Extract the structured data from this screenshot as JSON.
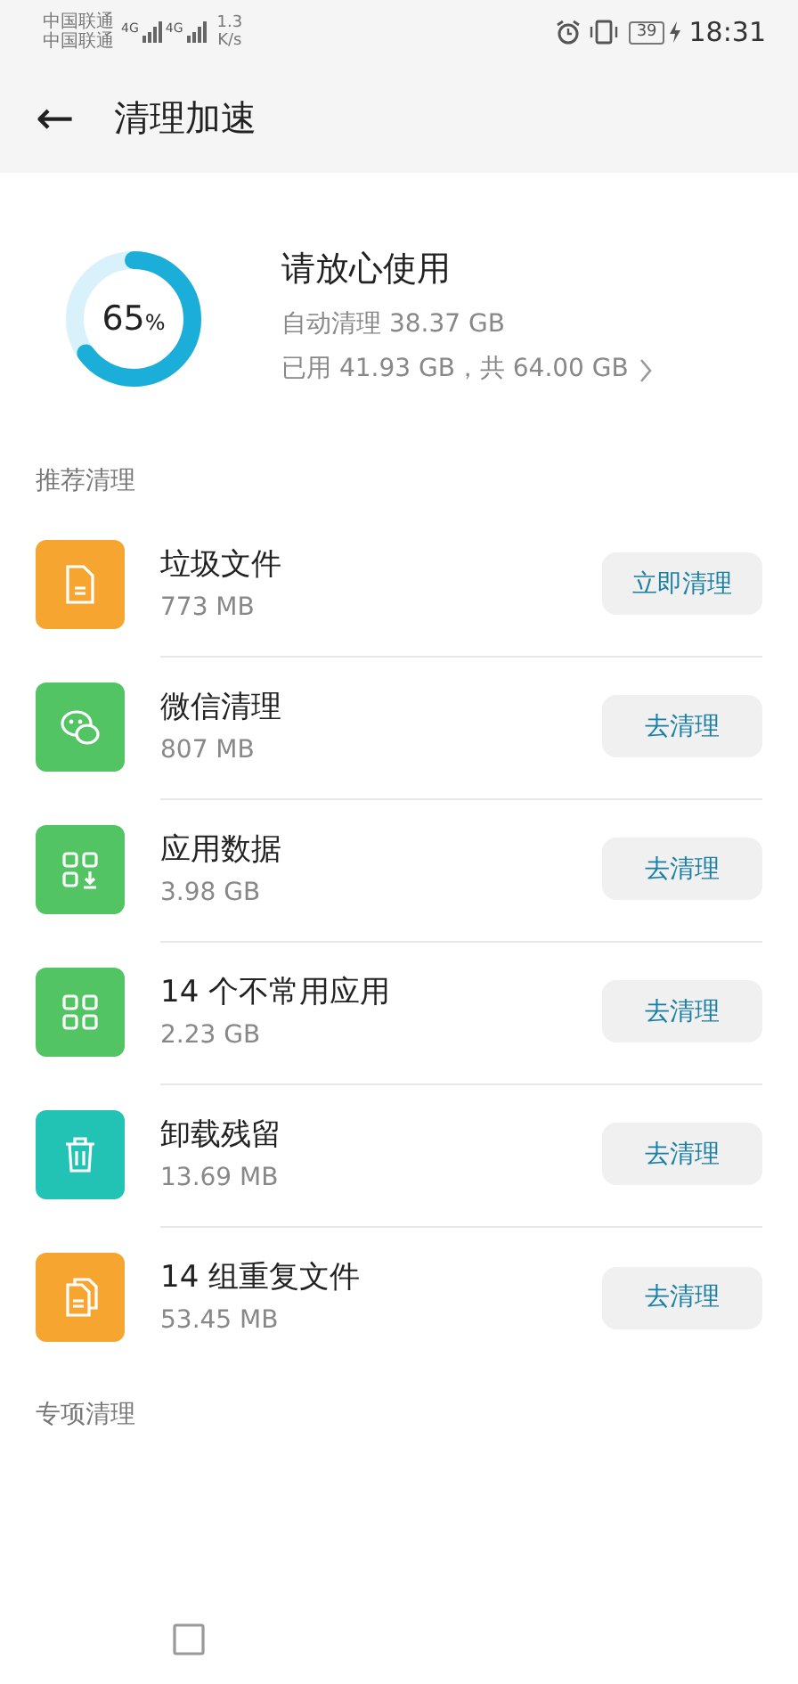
{
  "status_bar": {
    "carriers": [
      "中国联通",
      "中国联通"
    ],
    "network": [
      "4G",
      "4G"
    ],
    "speed": [
      "1.3",
      "K/s"
    ],
    "battery": "39",
    "time": "18:31"
  },
  "header": {
    "back": "←",
    "title": "清理加速"
  },
  "storage": {
    "level": 0.65,
    "percent": "65",
    "percent_sign": "%",
    "headline": "请放心使用",
    "auto_clean": "自动清理 38.37 GB",
    "usage": "已用 41.93 GB，共 64.00 GB"
  },
  "sections": [
    {
      "title": "推荐清理",
      "items": [
        {
          "kind": "file",
          "color": "#f7a531",
          "name": "垃圾文件",
          "size": "773 MB",
          "action": "立即清理"
        },
        {
          "kind": "chat",
          "color": "#52c463",
          "name": "微信清理",
          "size": "807 MB",
          "action": "去清理"
        },
        {
          "kind": "apps-down",
          "color": "#52c463",
          "name": "应用数据",
          "size": "3.98 GB",
          "action": "去清理"
        },
        {
          "kind": "apps",
          "color": "#52c463",
          "name": "14 个不常用应用",
          "size": "2.23 GB",
          "action": "去清理"
        },
        {
          "kind": "trash",
          "color": "#22c3b5",
          "name": "卸载残留",
          "size": "13.69 MB",
          "action": "去清理"
        },
        {
          "kind": "files",
          "color": "#f7a531",
          "name": "14 组重复文件",
          "size": "53.45 MB",
          "action": "去清理"
        }
      ]
    },
    {
      "title": "专项清理"
    }
  ]
}
